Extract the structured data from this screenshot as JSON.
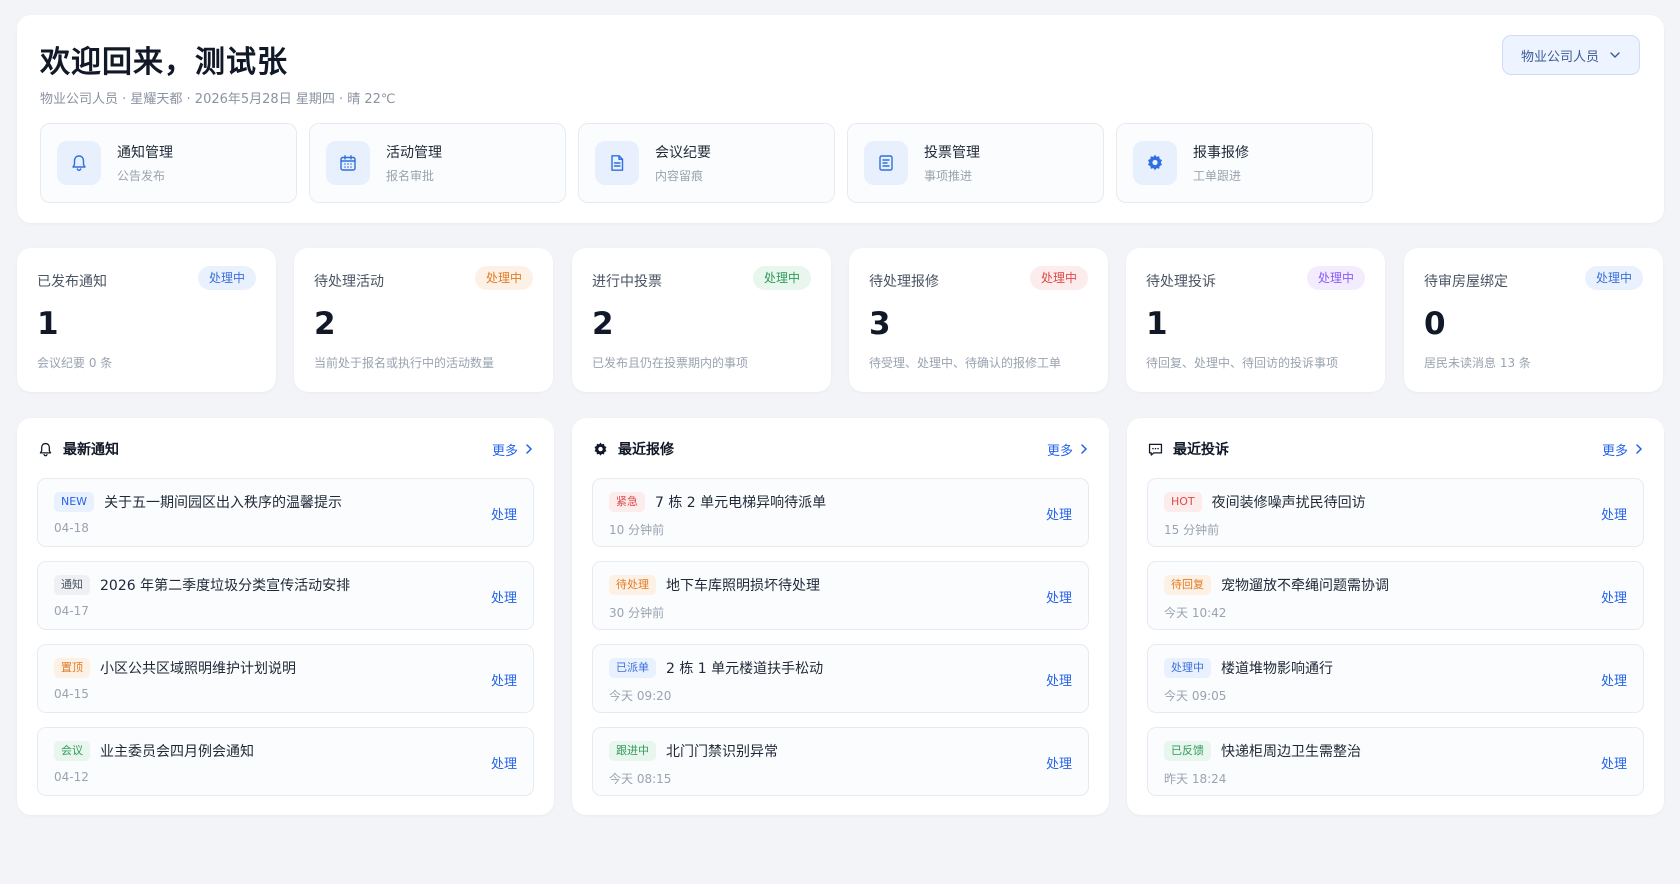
{
  "header": {
    "title": "欢迎回来，测试张",
    "subtitle": "物业公司人员 · 星耀天都 · 2026年5月28日 星期四 · 晴 22℃",
    "role_select": "物业公司人员",
    "quick_actions": [
      {
        "title": "通知管理",
        "desc": "公告发布",
        "icon": "bell-icon"
      },
      {
        "title": "活动管理",
        "desc": "报名审批",
        "icon": "calendar-icon"
      },
      {
        "title": "会议纪要",
        "desc": "内容留痕",
        "icon": "document-icon"
      },
      {
        "title": "投票管理",
        "desc": "事项推进",
        "icon": "ballot-icon"
      },
      {
        "title": "报事报修",
        "desc": "工单跟进",
        "icon": "gear-icon"
      }
    ]
  },
  "stats": [
    {
      "label": "已发布通知",
      "badge": "处理中",
      "value": "1",
      "note": "会议纪要 0 条",
      "badge_color": "#3b6fd8",
      "badge_bg": "#eaf1fe"
    },
    {
      "label": "待处理活动",
      "badge": "处理中",
      "value": "2",
      "note": "当前处于报名或执行中的活动数量",
      "badge_color": "#e07b24",
      "badge_bg": "#fdf1e6"
    },
    {
      "label": "进行中投票",
      "badge": "处理中",
      "value": "2",
      "note": "已发布且仍在投票期内的事项",
      "badge_color": "#2f9a5a",
      "badge_bg": "#e8f6ee"
    },
    {
      "label": "待处理报修",
      "badge": "处理中",
      "value": "3",
      "note": "待受理、处理中、待确认的报修工单",
      "badge_color": "#dc4a4a",
      "badge_bg": "#fdecec"
    },
    {
      "label": "待处理投诉",
      "badge": "处理中",
      "value": "1",
      "note": "待回复、处理中、待回访的投诉事项",
      "badge_color": "#8b5cf6",
      "badge_bg": "#f2ecfe"
    },
    {
      "label": "待审房屋绑定",
      "badge": "处理中",
      "value": "0",
      "note": "居民未读消息 13 条",
      "badge_color": "#3b6fd8",
      "badge_bg": "#eaf1fe"
    }
  ],
  "panels": [
    {
      "title": "最新通知",
      "icon": "bell-icon",
      "more": "更多",
      "items": [
        {
          "tag": "NEW",
          "tag_color": "#2563eb",
          "tag_bg": "#eaf1fe",
          "title": "关于五一期间园区出入秩序的温馨提示",
          "time": "04-18",
          "action": "处理"
        },
        {
          "tag": "通知",
          "tag_color": "#4b5563",
          "tag_bg": "#eef0f3",
          "title": "2026 年第二季度垃圾分类宣传活动安排",
          "time": "04-17",
          "action": "处理"
        },
        {
          "tag": "置顶",
          "tag_color": "#e07b24",
          "tag_bg": "#fdf1e6",
          "title": "小区公共区域照明维护计划说明",
          "time": "04-15",
          "action": "处理"
        },
        {
          "tag": "会议",
          "tag_color": "#2f9a5a",
          "tag_bg": "#e8f6ee",
          "title": "业主委员会四月例会通知",
          "time": "04-12",
          "action": "处理"
        }
      ]
    },
    {
      "title": "最近报修",
      "icon": "gear-icon",
      "more": "更多",
      "items": [
        {
          "tag": "紧急",
          "tag_color": "#dc4a4a",
          "tag_bg": "#fdecec",
          "title": "7 栋 2 单元电梯异响待派单",
          "time": "10 分钟前",
          "action": "处理"
        },
        {
          "tag": "待处理",
          "tag_color": "#e07b24",
          "tag_bg": "#fdf1e6",
          "title": "地下车库照明损坏待处理",
          "time": "30 分钟前",
          "action": "处理"
        },
        {
          "tag": "已派单",
          "tag_color": "#3b6fd8",
          "tag_bg": "#eaf1fe",
          "title": "2 栋 1 单元楼道扶手松动",
          "time": "今天 09:20",
          "action": "处理"
        },
        {
          "tag": "跟进中",
          "tag_color": "#2f9a5a",
          "tag_bg": "#e8f6ee",
          "title": "北门门禁识别异常",
          "time": "今天 08:15",
          "action": "处理"
        }
      ]
    },
    {
      "title": "最近投诉",
      "icon": "chat-icon",
      "more": "更多",
      "items": [
        {
          "tag": "HOT",
          "tag_color": "#dc4a4a",
          "tag_bg": "#fdecec",
          "title": "夜间装修噪声扰民待回访",
          "time": "15 分钟前",
          "action": "处理"
        },
        {
          "tag": "待回复",
          "tag_color": "#e07b24",
          "tag_bg": "#fdf1e6",
          "title": "宠物遛放不牵绳问题需协调",
          "time": "今天 10:42",
          "action": "处理"
        },
        {
          "tag": "处理中",
          "tag_color": "#3b6fd8",
          "tag_bg": "#eaf1fe",
          "title": "楼道堆物影响通行",
          "time": "今天 09:05",
          "action": "处理"
        },
        {
          "tag": "已反馈",
          "tag_color": "#2f9a5a",
          "tag_bg": "#e8f6ee",
          "title": "快递柜周边卫生需整治",
          "time": "昨天 18:24",
          "action": "处理"
        }
      ]
    }
  ]
}
